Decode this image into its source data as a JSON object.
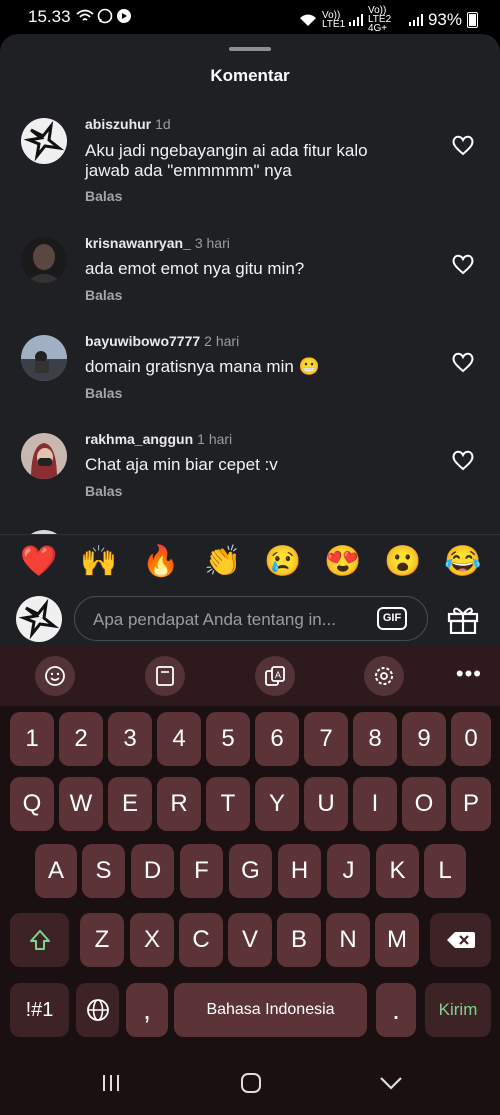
{
  "status_bar": {
    "time": "15.33",
    "battery": "93%",
    "sim1": "Vo)) LTE1",
    "sim2": "Vo)) LTE2 4G+"
  },
  "sheet": {
    "title": "Komentar"
  },
  "comments": [
    {
      "username": "abiszuhur",
      "time": "1d",
      "text": "Aku jadi ngebayangin ai ada fitur kalo jawab ada \"emmmmm\" nya",
      "reply": "Balas"
    },
    {
      "username": "krisnawanryan_",
      "time": "3 hari",
      "text": "ada emot emot nya gitu min?",
      "reply": "Balas"
    },
    {
      "username": "bayuwibowo7777",
      "time": "2 hari",
      "text": "domain gratisnya mana min 😬",
      "reply": "Balas"
    },
    {
      "username": "rakhma_anggun",
      "time": "1 hari",
      "text": "Chat aja min biar cepet :v",
      "reply": "Balas"
    }
  ],
  "emoji_bar": [
    "❤️",
    "🙌",
    "🔥",
    "👏",
    "😢",
    "😍",
    "😮",
    "😂"
  ],
  "input": {
    "placeholder": "Apa pendapat Anda tentang in...",
    "gif_label": "GIF"
  },
  "keyboard": {
    "toolbar": [
      "emoji-icon",
      "clipboard-icon",
      "translate-icon",
      "settings-icon",
      "more-icon"
    ],
    "more_label": "•••",
    "row_numbers": [
      "1",
      "2",
      "3",
      "4",
      "5",
      "6",
      "7",
      "8",
      "9",
      "0"
    ],
    "row1": [
      "Q",
      "W",
      "E",
      "R",
      "T",
      "Y",
      "U",
      "I",
      "O",
      "P"
    ],
    "row2": [
      "A",
      "S",
      "D",
      "F",
      "G",
      "H",
      "J",
      "K",
      "L"
    ],
    "row3": [
      "Z",
      "X",
      "C",
      "V",
      "B",
      "N",
      "M"
    ],
    "symbols_label": "!#1",
    "comma": ",",
    "space_label": "Bahasa Indonesia",
    "period": ".",
    "send_label": "Kirim"
  },
  "colors": {
    "sheet_bg": "#1e2023",
    "key": "#5c3438",
    "send_text": "#7fd48c",
    "shift_icon": "#7fd48c"
  }
}
